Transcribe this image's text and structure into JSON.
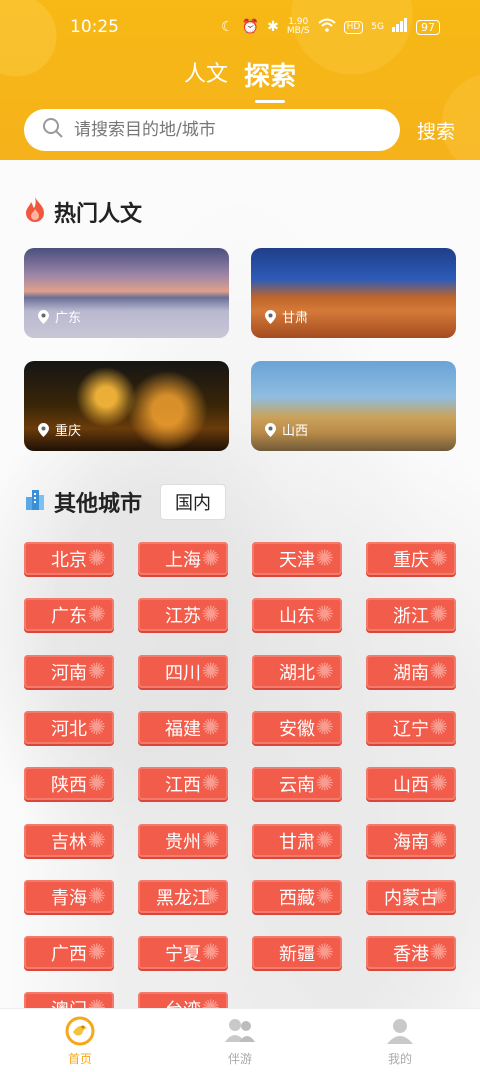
{
  "status": {
    "time": "10:25",
    "speed_value": "1.90",
    "speed_unit": "MB/S",
    "hd": "HD",
    "network": "5G",
    "battery": "97"
  },
  "tabs": [
    {
      "label": "人文",
      "active": false
    },
    {
      "label": "探索",
      "active": true
    }
  ],
  "search": {
    "placeholder": "请搜索目的地/城市",
    "button_label": "搜索"
  },
  "hot_section": {
    "title": "热门人文",
    "icon": "flame-icon",
    "cards": [
      {
        "location": "广东"
      },
      {
        "location": "甘肃"
      },
      {
        "location": "重庆"
      },
      {
        "location": "山西"
      }
    ]
  },
  "other_section": {
    "title": "其他城市",
    "icon": "city-icon",
    "filter_label": "国内",
    "cities": [
      "北京",
      "上海",
      "天津",
      "重庆",
      "广东",
      "江苏",
      "山东",
      "浙江",
      "河南",
      "四川",
      "湖北",
      "湖南",
      "河北",
      "福建",
      "安徽",
      "辽宁",
      "陕西",
      "江西",
      "云南",
      "山西",
      "吉林",
      "贵州",
      "甘肃",
      "海南",
      "青海",
      "黑龙江",
      "西藏",
      "内蒙古",
      "广西",
      "宁夏",
      "新疆",
      "香港",
      "澳门",
      "台湾"
    ]
  },
  "bottom_nav": [
    {
      "label": "首页",
      "icon": "home-dragon-icon",
      "active": true
    },
    {
      "label": "伴游",
      "icon": "companions-icon",
      "active": false
    },
    {
      "label": "我的",
      "icon": "profile-icon",
      "active": false
    }
  ],
  "colors": {
    "header": "#f7b915",
    "city_tag": "#f25c4b",
    "active_nav": "#f5a91a"
  }
}
